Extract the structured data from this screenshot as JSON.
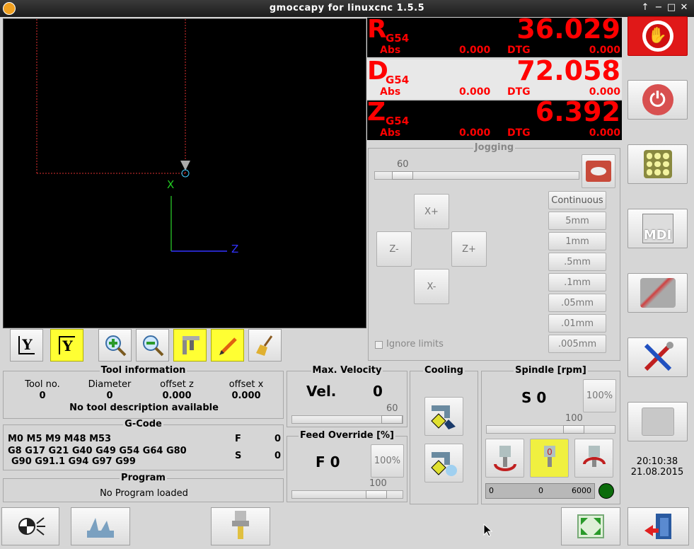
{
  "window": {
    "title": "gmoccapy for linuxcnc   1.5.5",
    "controls": [
      "↑",
      "−",
      "□",
      "✕"
    ]
  },
  "dro": [
    {
      "axis": "R",
      "cs": "G54",
      "value": "36.029",
      "abs_label": "Abs",
      "abs_value": "0.000",
      "dtg_label": "DTG",
      "dtg_value": "0.000"
    },
    {
      "axis": "D",
      "cs": "G54",
      "value": "72.058",
      "abs_label": "Abs",
      "abs_value": "0.000",
      "dtg_label": "DTG",
      "dtg_value": "0.000"
    },
    {
      "axis": "Z",
      "cs": "G54",
      "value": "6.392",
      "abs_label": "Abs",
      "abs_value": "0.000",
      "dtg_label": "DTG",
      "dtg_value": "0.000"
    }
  ],
  "jogging": {
    "title": "Jogging",
    "speed": "60",
    "buttons": {
      "x_plus": "X+",
      "x_minus": "X-",
      "z_plus": "Z+",
      "z_minus": "Z-"
    },
    "increments": [
      "Continuous",
      "5mm",
      "1mm",
      ".5mm",
      ".1mm",
      ".05mm",
      ".01mm",
      ".005mm"
    ],
    "ignore_limits": "Ignore limits"
  },
  "preview_axes": {
    "x": "X",
    "z": "Z"
  },
  "tool_info": {
    "title": "Tool information",
    "headers": [
      "Tool no.",
      "Diameter",
      "offset z",
      "offset x"
    ],
    "values": [
      "0",
      "0",
      "0.000",
      "0.000"
    ],
    "description": "No tool description available"
  },
  "gcode": {
    "title": "G-Code",
    "mcodes": "M0 M5 M9 M48 M53",
    "gcodes_1": "G8 G17 G21 G40 G49 G54 G64 G80",
    "gcodes_2": "G90 G91.1 G94 G97 G99",
    "f_label": "F",
    "f_value": "0",
    "s_label": "S",
    "s_value": "0"
  },
  "program": {
    "title": "Program",
    "text": "No Program loaded"
  },
  "max_velocity": {
    "title": "Max. Velocity",
    "label": "Vel.",
    "value": "0",
    "slider_value": "60"
  },
  "feed_override": {
    "title": "Feed Override [%]",
    "label": "F  0",
    "reset": "100%",
    "slider_value": "100"
  },
  "cooling": {
    "title": "Cooling"
  },
  "spindle": {
    "title": "Spindle [rpm]",
    "speed": "S 0",
    "reset": "100%",
    "slider_value": "100",
    "bar_min": "0",
    "bar_value": "0",
    "bar_max": "6000",
    "status_color": "#0b6b0b"
  },
  "clock": {
    "time": "20:10:38",
    "date": "21.08.2015"
  }
}
